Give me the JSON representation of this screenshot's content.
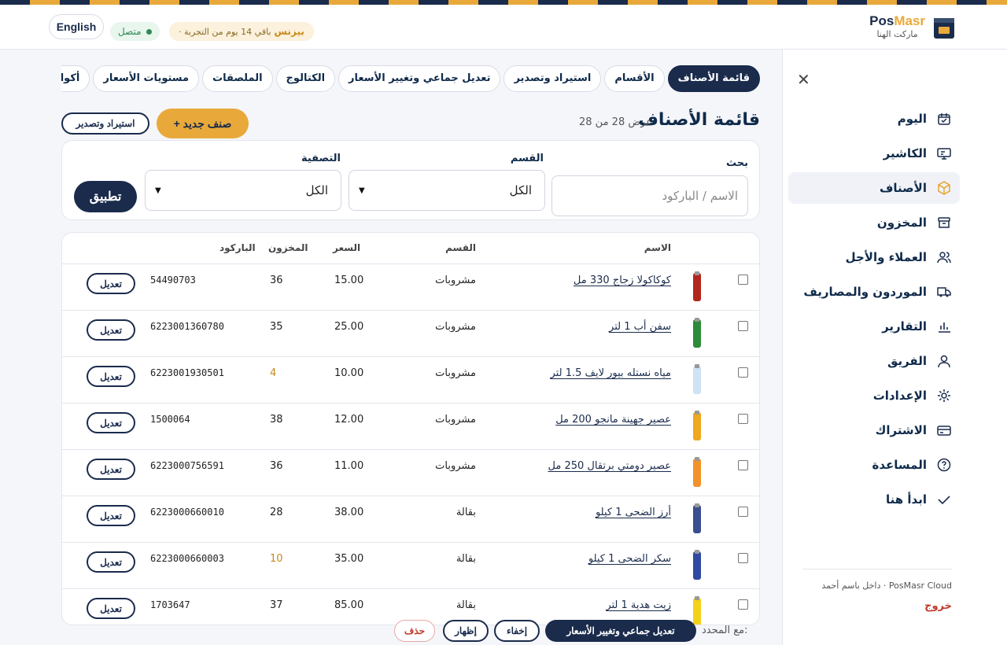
{
  "brand": {
    "name_a": "Pos",
    "name_b": "Masr",
    "subtitle": "ماركت الهنا"
  },
  "header": {
    "language": "English",
    "status": "متصل",
    "trial_plan": "بيزنس",
    "trial_text": "· باقي 14 يوم من التجربة"
  },
  "sidebar": {
    "items": [
      {
        "label": "اليوم",
        "icon": "calendar-check-icon"
      },
      {
        "label": "الكاشير",
        "icon": "monitor-icon"
      },
      {
        "label": "الأصناف",
        "icon": "box-icon",
        "active": true
      },
      {
        "label": "المخزون",
        "icon": "archive-icon"
      },
      {
        "label": "العملاء والأجل",
        "icon": "users-icon"
      },
      {
        "label": "الموردون والمصاريف",
        "icon": "truck-icon"
      },
      {
        "label": "التقارير",
        "icon": "bar-chart-icon"
      },
      {
        "label": "الفريق",
        "icon": "user-icon"
      },
      {
        "label": "الإعدادات",
        "icon": "gear-icon"
      },
      {
        "label": "الاشتراك",
        "icon": "credit-card-icon"
      },
      {
        "label": "المساعدة",
        "icon": "help-circle-icon"
      },
      {
        "label": "ابدأ هنا",
        "icon": "check-icon"
      }
    ],
    "footer_who": "داخل باسم أحمد · PosMasr Cloud",
    "logout": "خروج"
  },
  "tabs": [
    "قائمة الأصناف",
    "الأقسام",
    "استيراد وتصدير",
    "تعديل جماعي وتغيير الأسعار",
    "الكتالوج",
    "الملصقات",
    "مستويات الأسعار",
    "أكواد الضرائب"
  ],
  "page": {
    "title": "قائمة الأصناف",
    "count": "عرض 28 من 28",
    "new_button": "+ صنف جديد",
    "ie_button": "استيراد وتصدير"
  },
  "filters": {
    "search_label": "بحث",
    "search_placeholder": "الاسم / الباركود",
    "category_label": "القسم",
    "category_value": "الكل",
    "filter_label": "التصفية",
    "filter_value": "الكل",
    "apply": "تطبيق"
  },
  "table": {
    "headers": {
      "name": "الاسم",
      "category": "القسم",
      "price": "السعر",
      "stock": "المخزون",
      "barcode": "الباركود"
    },
    "rows": [
      {
        "name": "كوكاكولا زجاج 330 مل",
        "category": "مشروبات",
        "price": "15.00",
        "stock": "36",
        "barcode": "54490703",
        "thumb": "#b3261e",
        "low": false
      },
      {
        "name": "سفن أب 1 لتر",
        "category": "مشروبات",
        "price": "25.00",
        "stock": "35",
        "barcode": "6223001360780",
        "thumb": "#2e8b3a",
        "low": false
      },
      {
        "name": "مياه نستله بيور لايف 1.5 لتر",
        "category": "مشروبات",
        "price": "10.00",
        "stock": "4",
        "barcode": "6223001930501",
        "thumb": "#cfe3f5",
        "low": true
      },
      {
        "name": "عصير جهينة مانجو 200 مل",
        "category": "مشروبات",
        "price": "12.00",
        "stock": "38",
        "barcode": "1500064",
        "thumb": "#f0a81e",
        "low": false
      },
      {
        "name": "عصير دومتي برتقال 250 مل",
        "category": "مشروبات",
        "price": "11.00",
        "stock": "36",
        "barcode": "6223000756591",
        "thumb": "#f2922a",
        "low": false
      },
      {
        "name": "أرز الضحى 1 كيلو",
        "category": "بقالة",
        "price": "38.00",
        "stock": "28",
        "barcode": "6223000660010",
        "thumb": "#3a4f8f",
        "low": false
      },
      {
        "name": "سكر الضحى 1 كيلو",
        "category": "بقالة",
        "price": "35.00",
        "stock": "10",
        "barcode": "6223000660003",
        "thumb": "#2f4aa0",
        "low": true
      },
      {
        "name": "زيت هدية 1 لتر",
        "category": "بقالة",
        "price": "85.00",
        "stock": "37",
        "barcode": "1703647",
        "thumb": "#f4d21a",
        "low": false
      }
    ],
    "edit_label": "تعديل"
  },
  "bulk": {
    "label": "مع المحدد:",
    "bulk_edit": "تعديل جماعي وتغيير الأسعار",
    "hide": "إخفاء",
    "show": "إظهار",
    "delete": "حذف"
  },
  "colors": {
    "navy": "#1a2b4c",
    "gold": "#e8a93a",
    "danger": "#c0392b",
    "success": "#2f8a55"
  }
}
